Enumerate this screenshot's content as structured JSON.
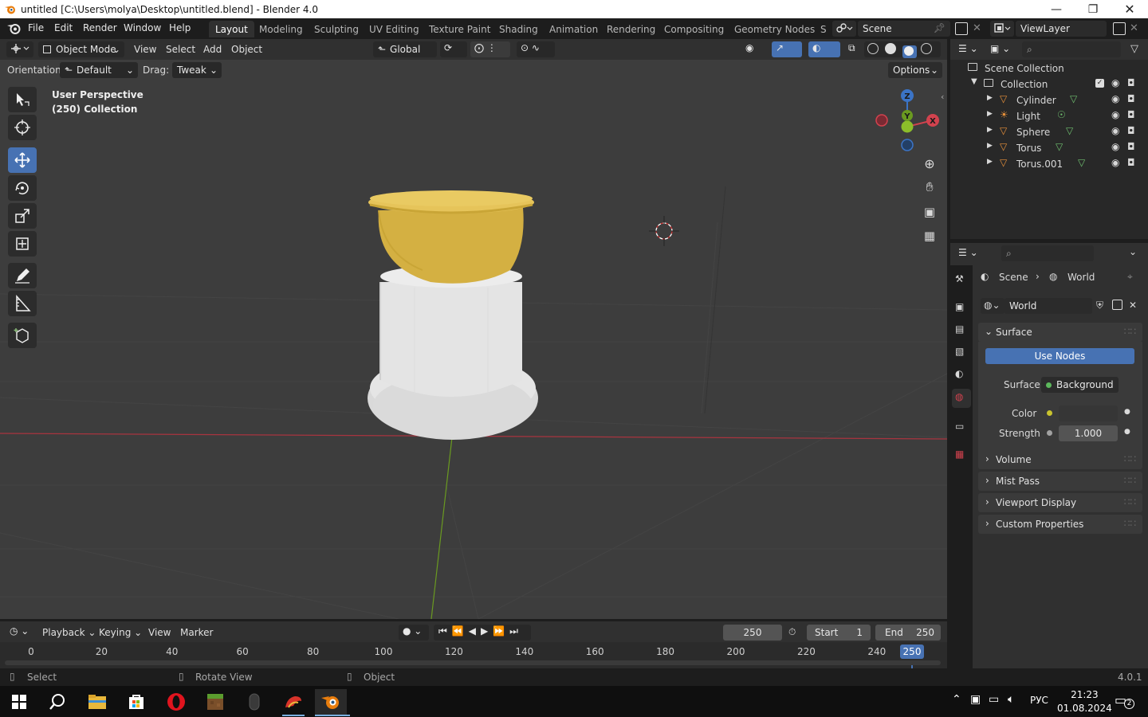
{
  "window": {
    "title": "untitled [C:\\Users\\molya\\Desktop\\untitled.blend] - Blender 4.0",
    "controls": [
      "minimize",
      "maximize",
      "close"
    ]
  },
  "menu": [
    "File",
    "Edit",
    "Render",
    "Window",
    "Help"
  ],
  "workspaces": {
    "tabs": [
      "Layout",
      "Modeling",
      "Sculpting",
      "UV Editing",
      "Texture Paint",
      "Shading",
      "Animation",
      "Rendering",
      "Compositing",
      "Geometry Nodes",
      "S"
    ],
    "active": "Layout"
  },
  "scene_selector": {
    "value": "Scene"
  },
  "viewlayer_selector": {
    "value": "ViewLayer"
  },
  "viewport": {
    "mode": "Object Mode",
    "menus": [
      "View",
      "Select",
      "Add",
      "Object"
    ],
    "transform_orientation": "Global",
    "orientation_label": "Orientation:",
    "orientation_value": "Default",
    "drag_label": "Drag:",
    "drag_value": "Tweak",
    "options_label": "Options",
    "overlay_line1": "User Perspective",
    "overlay_line2": "(250) Collection",
    "gizmo_axes": {
      "z": "Z",
      "x": "X",
      "y": "Y"
    },
    "colors": {
      "background": "#3d3d3d",
      "x_axis": "#a8343f",
      "y_axis": "#6a9a20",
      "object_yellow": "#d8b84a",
      "object_white": "#e3e3e3"
    }
  },
  "tools": [
    "select-box-icon",
    "cursor-icon",
    "move-icon",
    "rotate-icon",
    "scale-icon",
    "transform-icon",
    "annotate-icon",
    "measure-icon",
    "add-cube-icon"
  ],
  "outliner": {
    "root": "Scene Collection",
    "collection": "Collection",
    "items": [
      {
        "name": "Cylinder",
        "type": "mesh"
      },
      {
        "name": "Light",
        "type": "light"
      },
      {
        "name": "Sphere",
        "type": "mesh"
      },
      {
        "name": "Torus",
        "type": "mesh"
      },
      {
        "name": "Torus.001",
        "type": "mesh"
      }
    ]
  },
  "properties": {
    "breadcrumb_scene": "Scene",
    "breadcrumb_world": "World",
    "world_name": "World",
    "surface_panel": "Surface",
    "use_nodes": "Use Nodes",
    "surface_label": "Surface",
    "surface_value": "Background",
    "color_label": "Color",
    "strength_label": "Strength",
    "strength_value": "1.000",
    "collapsed_panels": [
      "Volume",
      "Mist Pass",
      "Viewport Display",
      "Custom Properties"
    ],
    "accent_color": "#4772b3"
  },
  "timeline": {
    "menus": [
      "Playback",
      "Keying",
      "View",
      "Marker"
    ],
    "current_frame": "250",
    "start_label": "Start",
    "start_value": "1",
    "end_label": "End",
    "end_value": "250",
    "ticks": [
      "0",
      "20",
      "40",
      "60",
      "80",
      "100",
      "120",
      "140",
      "160",
      "180",
      "200",
      "220",
      "240"
    ],
    "playhead": "250"
  },
  "statusbar": {
    "left": "Select",
    "middle": "Rotate View",
    "right": "Object",
    "version": "4.0.1"
  },
  "taskbar": {
    "apps": [
      "windows-start-icon",
      "search-icon",
      "file-explorer-icon",
      "store-icon",
      "opera-icon",
      "minecraft-icon",
      "mouse-icon",
      "game-icon",
      "blender-icon"
    ],
    "language": "РУС",
    "time": "21:23",
    "date": "01.08.2024",
    "notifications": "2"
  }
}
